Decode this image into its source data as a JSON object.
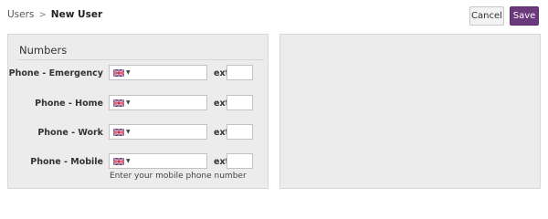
{
  "breadcrumb": {
    "parent": "Users",
    "separator": ">",
    "current": "New User"
  },
  "toolbar": {
    "cancel_label": "Cancel",
    "save_label": "Save"
  },
  "numbers_section": {
    "title": "Numbers",
    "ext_label": "ext",
    "fields": [
      {
        "label": "Phone - Emergency",
        "country_flag": "uk-flag-icon",
        "value": "",
        "ext_value": ""
      },
      {
        "label": "Phone - Home",
        "country_flag": "uk-flag-icon",
        "value": "",
        "ext_value": ""
      },
      {
        "label": "Phone - Work",
        "country_flag": "uk-flag-icon",
        "value": "",
        "ext_value": ""
      },
      {
        "label": "Phone - Mobile",
        "country_flag": "uk-flag-icon",
        "value": "",
        "ext_value": ""
      }
    ],
    "mobile_help": "Enter your mobile phone number"
  },
  "colors": {
    "accent": "#6b3a7d",
    "panel_bg": "#ececec"
  }
}
